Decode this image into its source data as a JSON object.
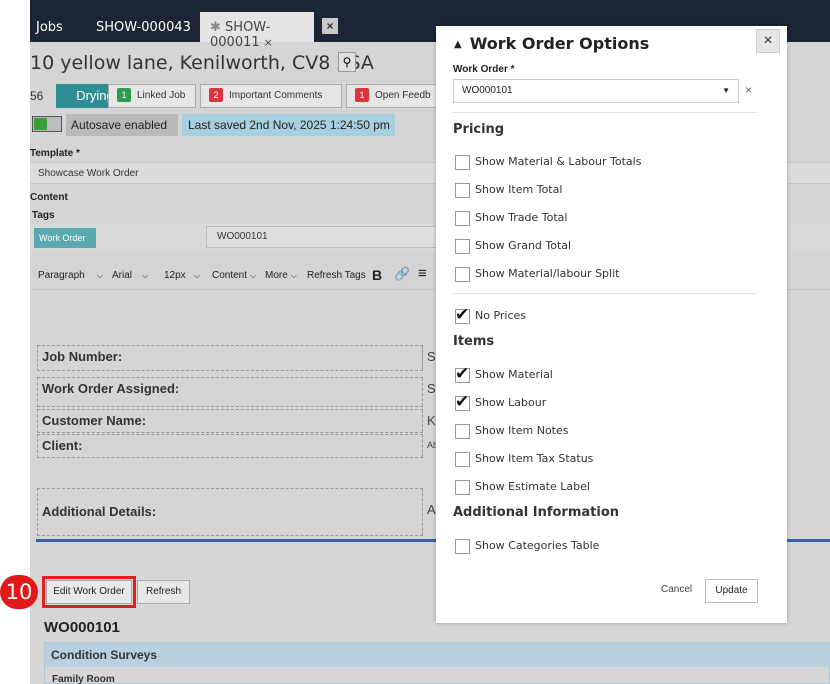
{
  "tabs": [
    {
      "label": "Jobs"
    },
    {
      "label": "SHOW-000043"
    },
    {
      "label": "SHOW-000011",
      "close": "×"
    }
  ],
  "tab_close_all": "×",
  "address": "10 yellow lane, Kenilworth, CV8 2SA",
  "job_number_partial": "56",
  "status": "Drying",
  "pills": [
    {
      "count": "1",
      "label": "Linked Job",
      "color": "#2e9b4e"
    },
    {
      "count": "2",
      "label": "Important Comments",
      "color": "#d9363e"
    },
    {
      "count": "1",
      "label": "Open Feedb",
      "color": "#d9363e"
    }
  ],
  "autosave": "Autosave enabled",
  "last_saved": "Last saved 2nd Nov, 2025 1:24:50 pm",
  "template_label": "Template *",
  "template_value": "Showcase Work Order",
  "content_label": "Content",
  "tags_label": "Tags",
  "tag_chip": "Work Order",
  "tag_value": "WO000101",
  "toolbar": {
    "paragraph": "Paragraph",
    "font": "Arial",
    "size": "12px",
    "content": "Content",
    "more": "More",
    "refresh_tags": "Refresh Tags",
    "bold": "B",
    "link": "🔗",
    "align": "≡"
  },
  "table": {
    "job_number": "Job Number:",
    "work_order_assigned": "Work Order Assigned:",
    "customer_name": "Customer Name:",
    "client": "Client:",
    "additional_details": "Additional Details:",
    "r1": "S",
    "r2": "S",
    "r3": "K",
    "r4": "Ab",
    "r5": "A"
  },
  "buttons": {
    "edit_work_order": "Edit Work Order",
    "refresh": "Refresh"
  },
  "step_number": "10",
  "work_order_id": "WO000101",
  "condition_surveys": "Condition Surveys",
  "family_room": "Family Room",
  "modal": {
    "title": "Work Order Options",
    "close": "×",
    "work_order_label": "Work Order *",
    "work_order_value": "WO000101",
    "clear": "×",
    "pricing": "Pricing",
    "pricing_options": [
      {
        "label": "Show Material & Labour Totals",
        "checked": false
      },
      {
        "label": "Show Item Total",
        "checked": false
      },
      {
        "label": "Show Trade Total",
        "checked": false
      },
      {
        "label": "Show Grand Total",
        "checked": false
      },
      {
        "label": "Show Material/labour Split",
        "checked": false
      }
    ],
    "no_prices": {
      "label": "No Prices",
      "checked": true
    },
    "items": "Items",
    "item_options": [
      {
        "label": "Show Material",
        "checked": true
      },
      {
        "label": "Show Labour",
        "checked": true
      },
      {
        "label": "Show Item Notes",
        "checked": false
      },
      {
        "label": "Show Item Tax Status",
        "checked": false
      },
      {
        "label": "Show Estimate Label",
        "checked": false
      }
    ],
    "additional_information": "Additional Information",
    "show_categories": {
      "label": "Show Categories Table",
      "checked": false
    },
    "cancel": "Cancel",
    "update": "Update"
  }
}
